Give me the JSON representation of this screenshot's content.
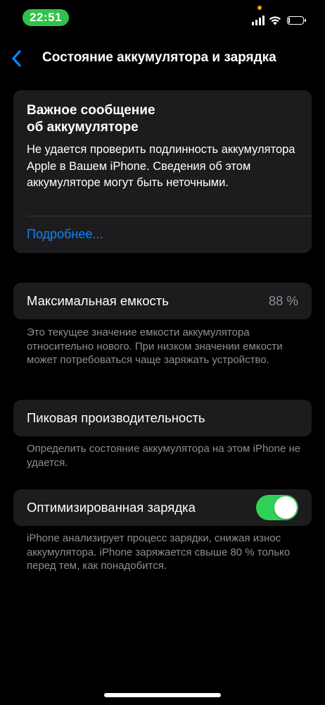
{
  "status_bar": {
    "time": "22:51",
    "icons": [
      "signal-icon",
      "wifi-icon",
      "battery-icon"
    ],
    "time_pill_color": "#30c24a"
  },
  "nav": {
    "back_icon": "chevron-left-icon",
    "title": "Состояние аккумулятора и зарядка"
  },
  "alert": {
    "title": "Важное сообщение\nоб аккумуляторе",
    "body": "Не удается проверить подлинность аккумулятора Apple в Вашем iPhone. Сведения об этом аккумуляторе могут быть неточными.",
    "link": "Подробнее..."
  },
  "max_capacity": {
    "label": "Максимальная емкость",
    "value": "88 %",
    "footnote": "Это текущее значение емкости аккумулятора относительно нового. При низком значении емкости может потребоваться чаще заряжать устройство."
  },
  "peak_performance": {
    "label": "Пиковая производительность",
    "footnote": "Определить состояние аккумулятора на этом iPhone не удается."
  },
  "optimized_charging": {
    "label": "Оптимизированная зарядка",
    "enabled": true,
    "toggle_color": "#30d158",
    "footnote": "iPhone анализирует процесс зарядки, снижая износ аккумулятора. iPhone заряжается свыше 80 % только перед тем, как понадобится."
  },
  "colors": {
    "background": "#000000",
    "card": "#1c1c1e",
    "link": "#0a84ff",
    "secondary_text": "#8e8e93"
  }
}
